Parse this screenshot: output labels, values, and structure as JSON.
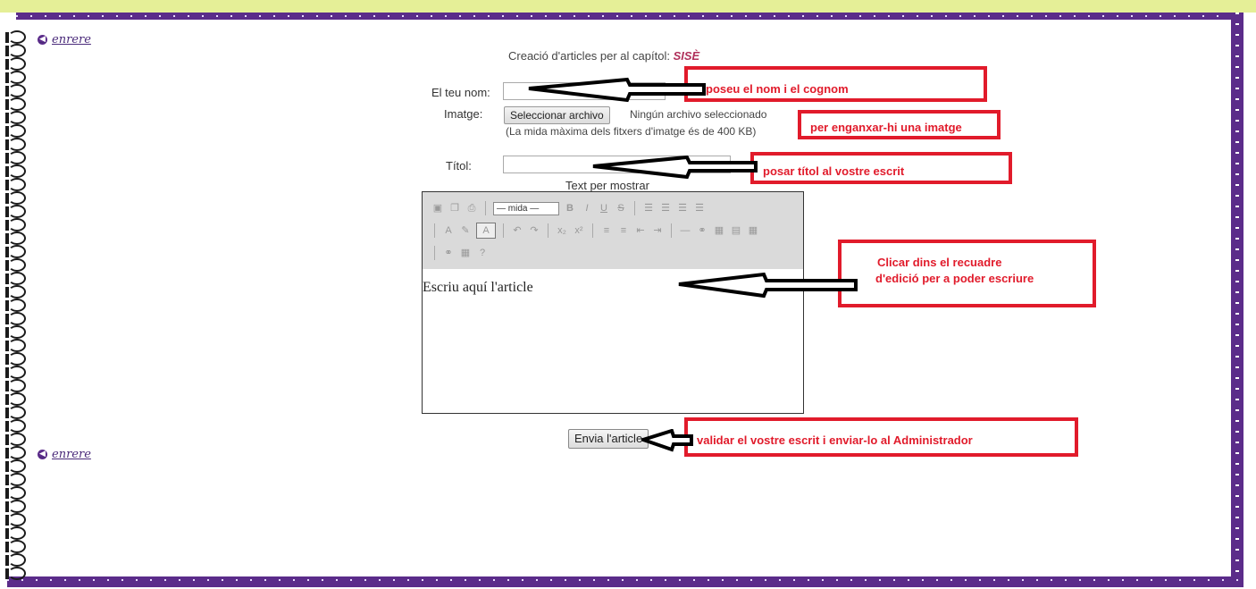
{
  "nav": {
    "back_label": "enrere",
    "back_icon": "circle-left-icon"
  },
  "form": {
    "heading_prefix": "Creació d'articles per al capítol:",
    "chapter": "SISÈ",
    "name_label": "El teu nom:",
    "name_value": "",
    "image_label": "Imatge:",
    "file_button": "Seleccionar archivo",
    "file_status": "Ningún archivo seleccionado",
    "size_note": "(La mida màxima dels fitxers d'imatge és de 400 KB)",
    "title_label": "Títol:",
    "title_value": "",
    "editor_caption": "Text per mostrar",
    "font_size_select": "— mida —",
    "editor_text": "Escriu aquí l'article",
    "submit_label": "Envia l'article"
  },
  "annotations": {
    "name": "poseu el nom i el cognom",
    "image": "per enganxar-hi una imatge",
    "title": "posar títol al vostre escrit",
    "editor_line1": "Clicar dins el recuadre",
    "editor_line2": "d'edició per a poder escriure",
    "submit": "validar el vostre escrit i enviar-lo al Administrador"
  },
  "colors": {
    "frame": "#5b2c8a",
    "annotation": "#e11b2b",
    "top_strip": "#e5ef97"
  }
}
